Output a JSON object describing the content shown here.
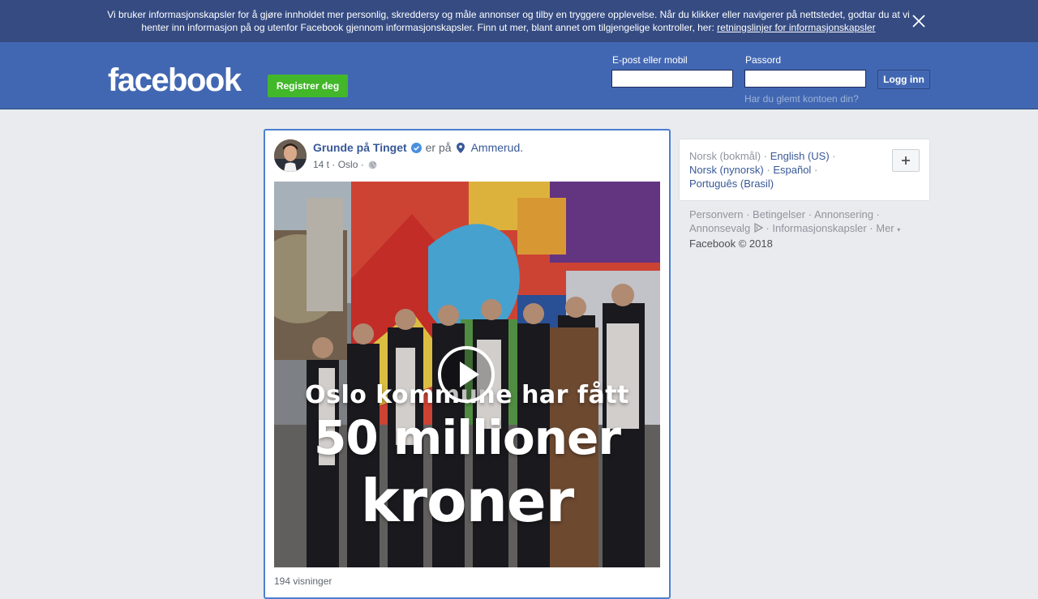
{
  "cookie_banner": {
    "text": "Vi bruker informasjonskapsler for å gjøre innholdet mer personlig, skreddersy og måle annonser og tilby en tryggere opplevelse. Når du klikker eller navigerer på nettstedet, godtar du at vi henter inn informasjon på og utenfor Facebook gjennom informasjonskapsler. Finn ut mer, blant annet om tilgjengelige kontroller, her: ",
    "link": "retningslinjer for informasjonskapsler",
    "close_icon": "close-icon"
  },
  "header": {
    "logo": "facebook",
    "register_label": "Registrer deg",
    "email_label": "E-post eller mobil",
    "email_value": "",
    "password_label": "Passord",
    "password_value": "",
    "login_label": "Logg inn",
    "forgot_label": "Har du glemt kontoen din?"
  },
  "post": {
    "author": "Grunde på Tinget",
    "verified_icon": "verified-badge-icon",
    "is_at": "er på",
    "location_icon": "location-pin-icon",
    "place": "Ammerud.",
    "time": "14 t",
    "city": "Oslo",
    "privacy_icon": "globe-icon",
    "video_lines": [
      "Oslo kommune har fått",
      "50 millioner",
      "kroner"
    ],
    "play_icon": "play-icon",
    "views": "194 visninger"
  },
  "languages": {
    "current": "Norsk (bokmål)",
    "items": [
      "English (US)",
      "Norsk (nynorsk)",
      "Español",
      "Português (Brasil)"
    ],
    "add_icon": "plus-icon"
  },
  "footer": {
    "links": [
      "Personvern",
      "Betingelser",
      "Annonsering",
      "Annonsevalg",
      "Informasjonskapsler",
      "Mer"
    ],
    "copyright": "Facebook © 2018"
  },
  "colors": {
    "brand_blue": "#4267b2",
    "banner_blue": "#354b82",
    "register_green": "#42b72a",
    "link_blue": "#385898"
  }
}
